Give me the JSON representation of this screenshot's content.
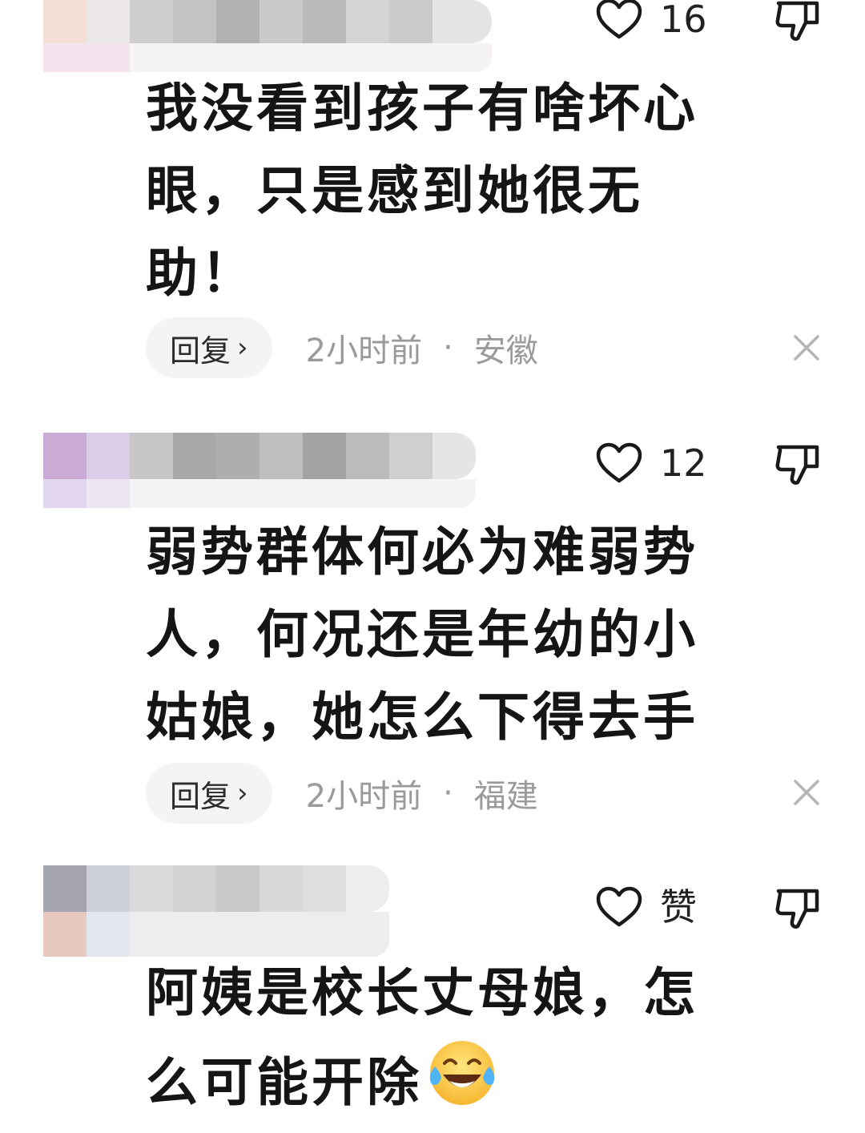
{
  "comments": [
    {
      "likes": "16",
      "text_lines": [
        "我没看到孩子有啥坏心",
        "眼，只是感到她很无",
        "助！"
      ],
      "reply_label": "回复",
      "time": "2小时前",
      "separator": "·",
      "region": "安徽"
    },
    {
      "likes": "12",
      "text_lines": [
        "弱势群体何必为难弱势",
        "人，何况还是年幼的小",
        "姑娘，她怎么下得去手"
      ],
      "reply_label": "回复",
      "time": "2小时前",
      "separator": "·",
      "region": "福建"
    },
    {
      "likes": "赞",
      "text_lines": [
        "阿姨是校长丈母娘，怎",
        "么可能开除"
      ],
      "emoji": "face-with-tears-of-joy"
    }
  ],
  "icons": {
    "like": "heart-outline-icon",
    "dislike": "thumbs-down-outline-icon",
    "dismiss": "close-icon"
  }
}
